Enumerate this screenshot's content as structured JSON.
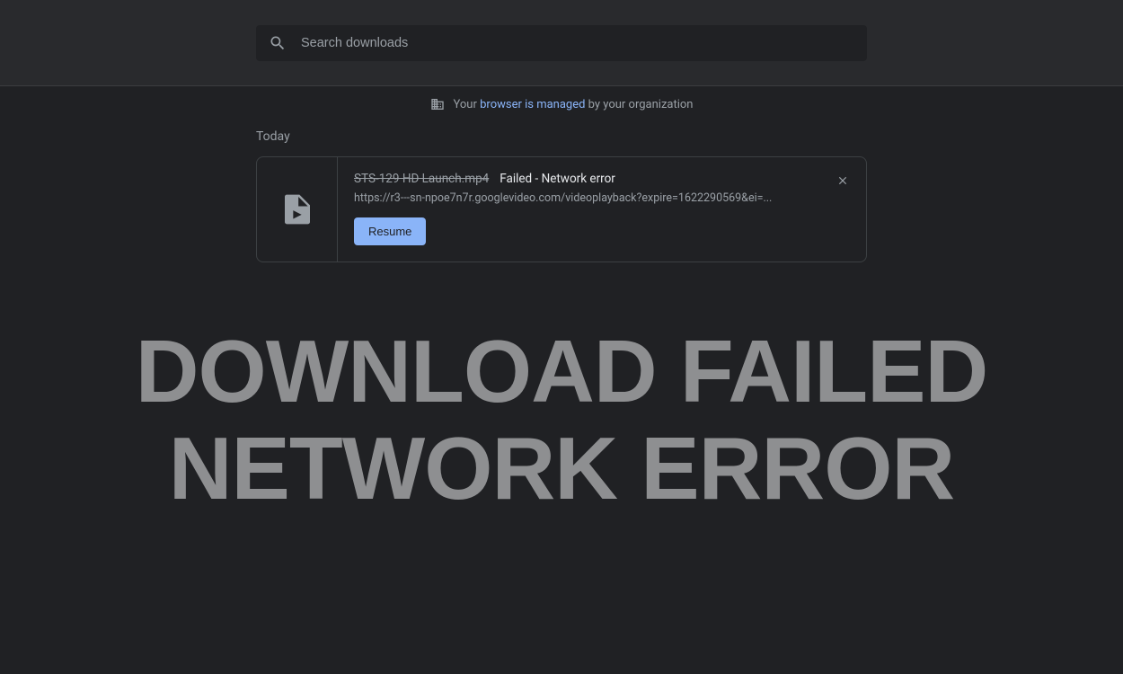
{
  "search": {
    "placeholder": "Search downloads"
  },
  "managed": {
    "prefix": "Your ",
    "link": "browser is managed",
    "suffix": " by your organization"
  },
  "section": {
    "label": "Today"
  },
  "download": {
    "filename": "STS-129 HD Launch.mp4",
    "status": "Failed - Network error",
    "url": "https://r3---sn-npoe7n7r.googlevideo.com/videoplayback?expire=1622290569&ei=...",
    "resume_label": "Resume"
  },
  "overlay": {
    "line1": "DOWNLOAD FAILED",
    "line2": "NETWORK ERROR"
  }
}
